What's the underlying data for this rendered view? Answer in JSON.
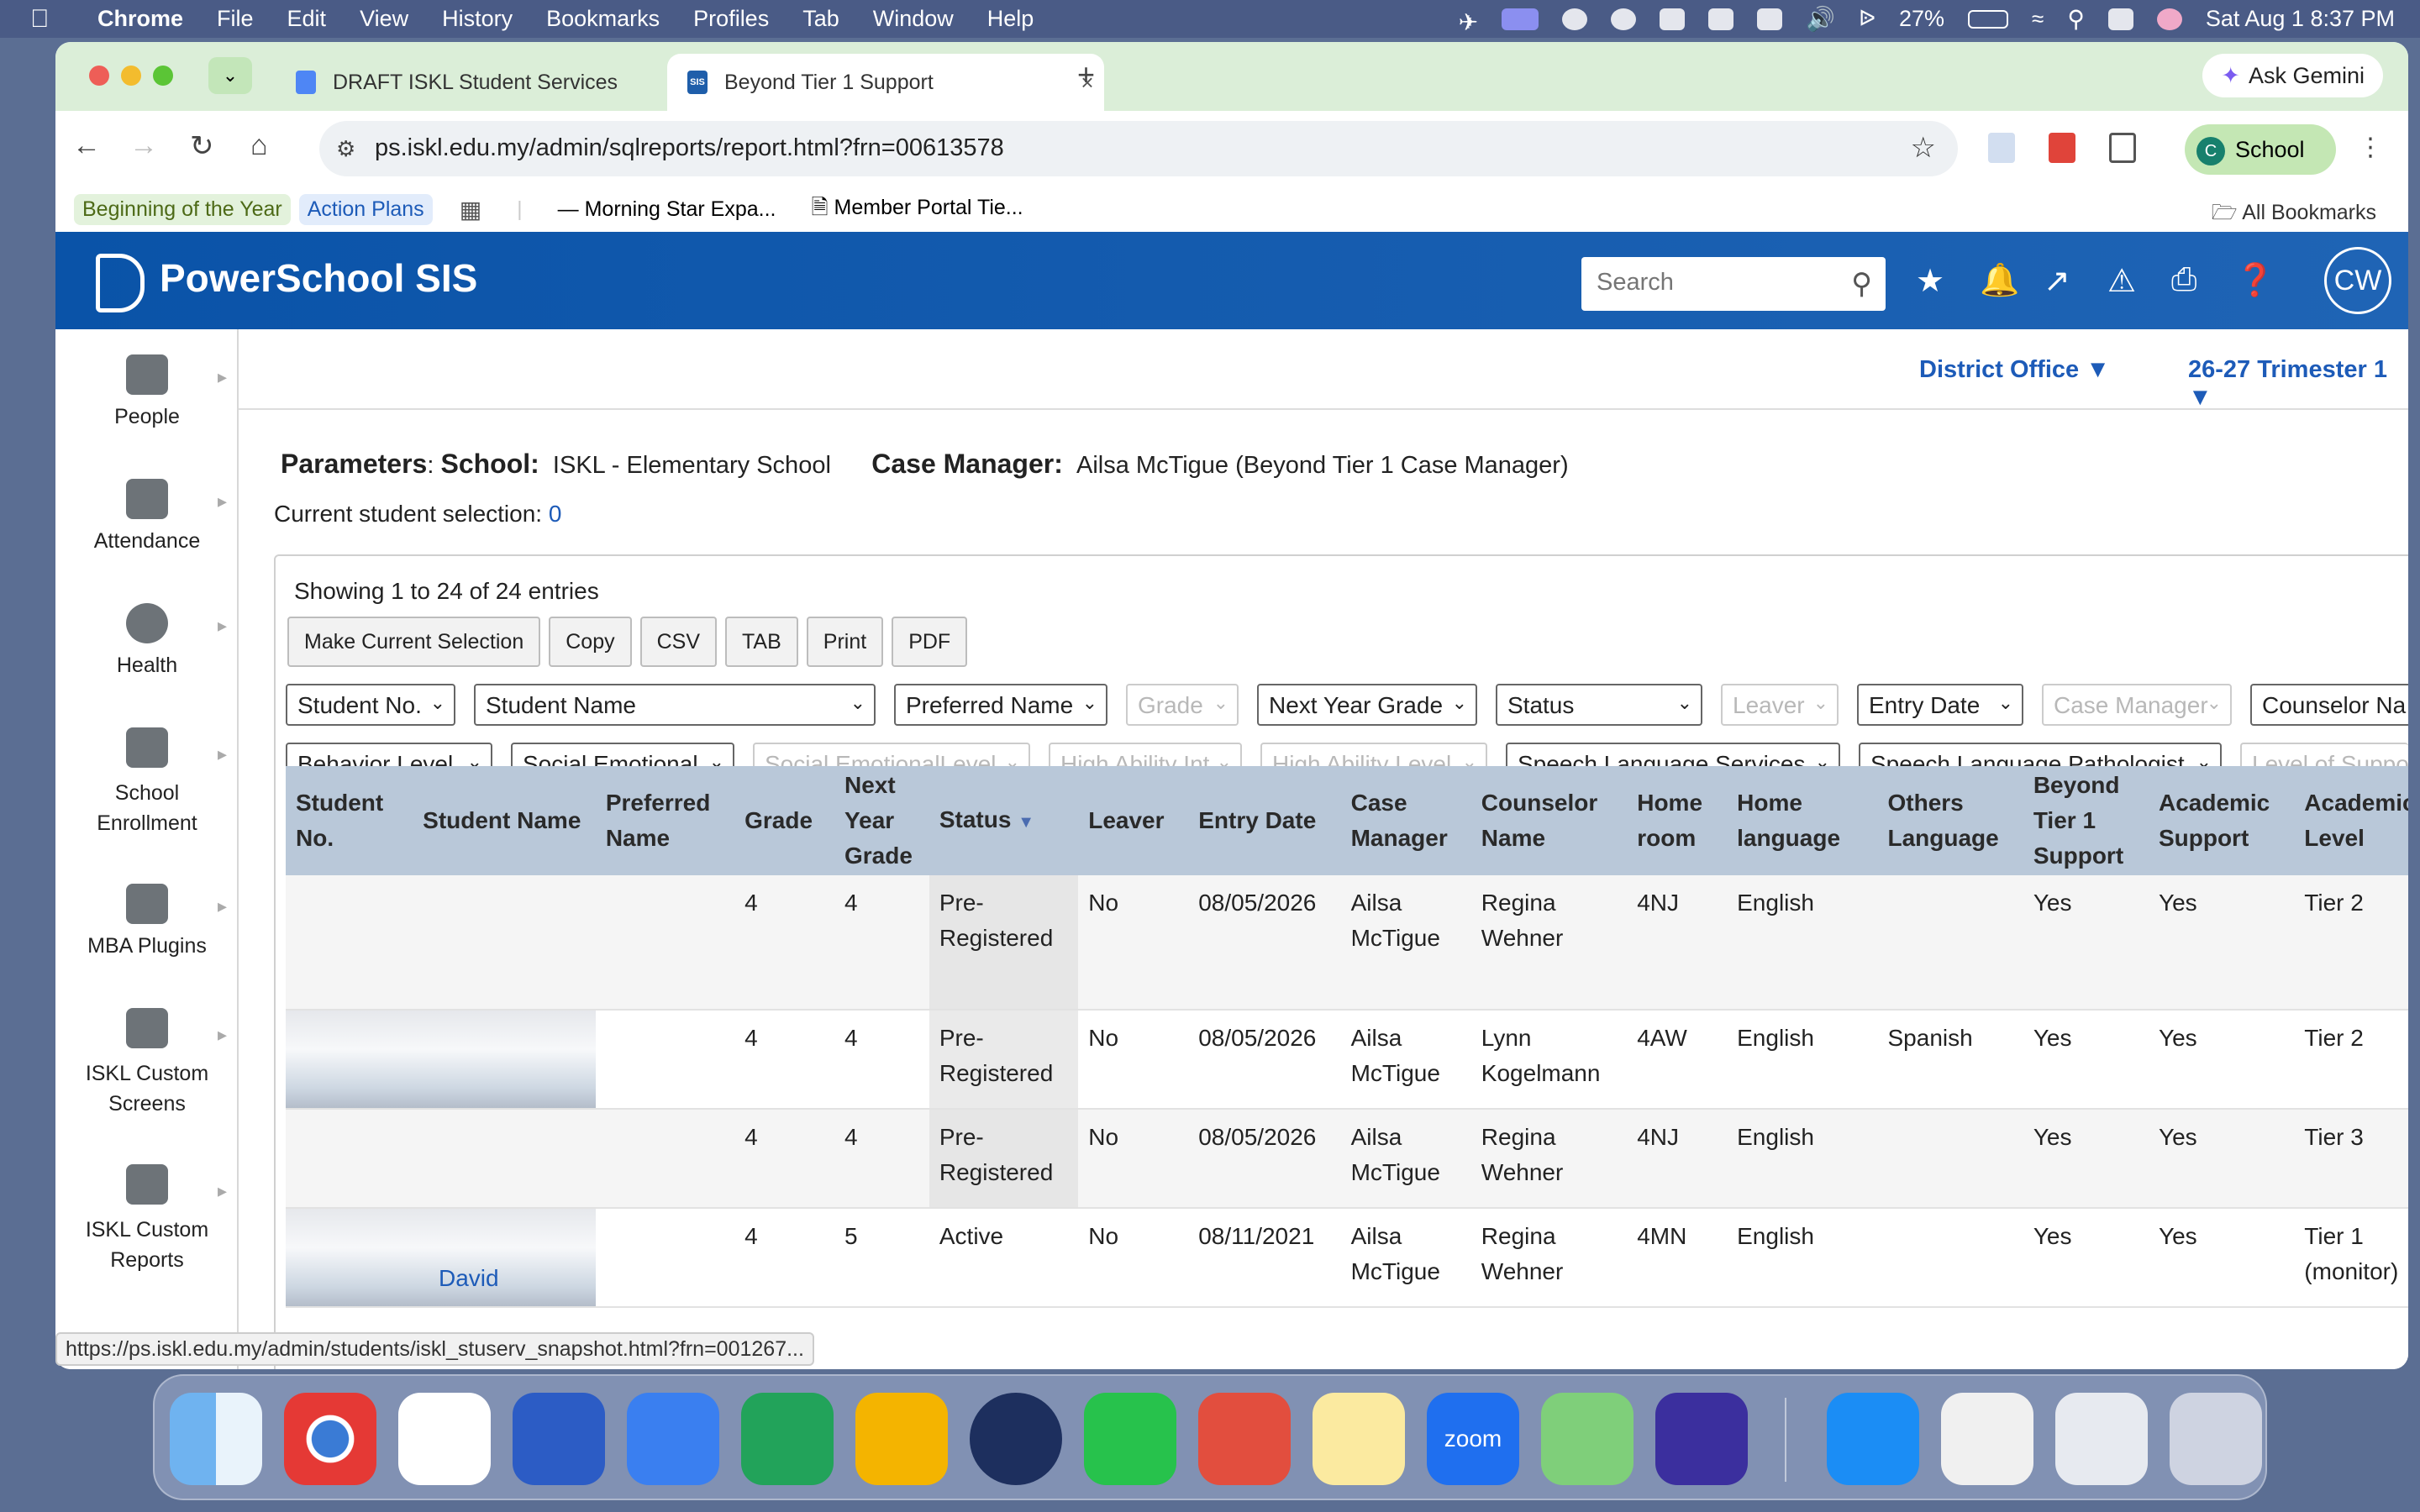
{
  "menubar": {
    "apple_icon": "apple-icon",
    "app_name": "Chrome",
    "items": [
      "File",
      "Edit",
      "View",
      "History",
      "Bookmarks",
      "Profiles",
      "Tab",
      "Window",
      "Help"
    ],
    "battery": "27%",
    "datetime": "Sat Aug 1  8:37 PM"
  },
  "browser": {
    "tabs": [
      {
        "label": "DRAFT ISKL Student Services",
        "active": false
      },
      {
        "label": "Beyond Tier 1 Support",
        "active": true
      }
    ],
    "favicon_sis": "SIS",
    "ask_gemini": "Ask Gemini",
    "url": "ps.iskl.edu.my/admin/sqlreports/report.html?frn=00613578",
    "profile_initial": "C",
    "profile_label": "School",
    "bookmarks": [
      "Beginning of the Year",
      "Action Plans",
      "Morning Star Expa...",
      "Member Portal Tie..."
    ],
    "all_bookmarks": "All Bookmarks"
  },
  "powerschool": {
    "title": "PowerSchool SIS",
    "search_placeholder": "Search",
    "user_initials": "CW",
    "district": "District Office",
    "term": "26-27 Trimester 1"
  },
  "sidebar": {
    "items": [
      {
        "label": "People",
        "icon": "people-icon"
      },
      {
        "label": "Attendance",
        "icon": "attendance-icon"
      },
      {
        "label": "Health",
        "icon": "health-icon"
      },
      {
        "label": "School Enrollment",
        "icon": "school-enrollment-icon"
      },
      {
        "label": "MBA Plugins",
        "icon": "plugin-icon"
      },
      {
        "label": "ISKL Custom Screens",
        "icon": "custom-screens-icon"
      },
      {
        "label": "ISKL Custom Reports",
        "icon": "custom-reports-icon"
      }
    ]
  },
  "report": {
    "params_label": "Parameters",
    "school_label": "School:",
    "school_value": "ISKL - Elementary School",
    "case_manager_label": "Case Manager:",
    "case_manager_value": "Ailsa McTigue (Beyond Tier 1 Case Manager)",
    "current_selection_label": "Current student selection:",
    "current_selection_count": "0",
    "showing": "Showing 1 to 24 of 24 entries",
    "buttons": [
      "Make Current Selection",
      "Copy",
      "CSV",
      "TAB",
      "Print",
      "PDF"
    ],
    "filters_row1": [
      {
        "label": "Student No.",
        "enabled": true
      },
      {
        "label": "Student Name",
        "enabled": true
      },
      {
        "label": "Preferred Name",
        "enabled": true
      },
      {
        "label": "Grade",
        "enabled": false
      },
      {
        "label": "Next Year Grade",
        "enabled": true
      },
      {
        "label": "Status",
        "enabled": true
      },
      {
        "label": "Leaver",
        "enabled": false
      },
      {
        "label": "Entry Date",
        "enabled": true
      },
      {
        "label": "Case Manager",
        "enabled": false
      },
      {
        "label": "Counselor Na",
        "enabled": true
      }
    ],
    "filters_row2": [
      {
        "label": "Behavior Level",
        "enabled": true
      },
      {
        "label": "Social Emotional",
        "enabled": true
      },
      {
        "label": "Social EmotionalLevel",
        "enabled": false
      },
      {
        "label": "High Ability Int",
        "enabled": false
      },
      {
        "label": "High Ability Level",
        "enabled": false
      },
      {
        "label": "Speech Language Services",
        "enabled": true
      },
      {
        "label": "Speech Language Pathologist",
        "enabled": true
      },
      {
        "label": "Level of Suppor",
        "enabled": false
      }
    ],
    "columns": [
      "Student No.",
      "Student Name",
      "Preferred Name",
      "Grade",
      "Next Year Grade",
      "Status",
      "Leaver",
      "Entry Date",
      "Case Manager",
      "Counselor Name",
      "Home room",
      "Home language",
      "Others Language",
      "Beyond Tier 1 Support",
      "Academic Support",
      "Academic Level"
    ],
    "rows": [
      {
        "student_no": "",
        "student_name": "",
        "preferred_name": "",
        "grade": "4",
        "next_grade": "4",
        "status": "Pre-Registered",
        "leaver": "No",
        "entry_date": "08/05/2026",
        "case_manager": "Ailsa McTigue",
        "counselor": "Regina Wehner",
        "homeroom": "4NJ",
        "home_language": "English",
        "other_language": "",
        "beyond_tier1": "Yes",
        "academic_support": "Yes",
        "academic_level": "Tier 2"
      },
      {
        "student_no": "",
        "student_name": "",
        "preferred_name": "",
        "grade": "4",
        "next_grade": "4",
        "status": "Pre-Registered",
        "leaver": "No",
        "entry_date": "08/05/2026",
        "case_manager": "Ailsa McTigue",
        "counselor": "Lynn Kogelmann",
        "homeroom": "4AW",
        "home_language": "English",
        "other_language": "Spanish",
        "beyond_tier1": "Yes",
        "academic_support": "Yes",
        "academic_level": "Tier 2"
      },
      {
        "student_no": "",
        "student_name": "",
        "preferred_name": "",
        "grade": "4",
        "next_grade": "4",
        "status": "Pre-Registered",
        "leaver": "No",
        "entry_date": "08/05/2026",
        "case_manager": "Ailsa McTigue",
        "counselor": "Regina Wehner",
        "homeroom": "4NJ",
        "home_language": "English",
        "other_language": "",
        "beyond_tier1": "Yes",
        "academic_support": "Yes",
        "academic_level": "Tier 3"
      },
      {
        "student_no": "",
        "student_name": "David",
        "preferred_name": "",
        "grade": "4",
        "next_grade": "5",
        "status": "Active",
        "leaver": "No",
        "entry_date": "08/11/2021",
        "case_manager": "Ailsa McTigue",
        "counselor": "Regina Wehner",
        "homeroom": "4MN",
        "home_language": "English",
        "other_language": "",
        "beyond_tier1": "Yes",
        "academic_support": "Yes",
        "academic_level": "Tier 1 (monitor)"
      }
    ]
  },
  "status_url": "https://ps.iskl.edu.my/admin/students/iskl_stuserv_snapshot.html?frn=001267...",
  "dock": {
    "apps": [
      "Finder",
      "Chrome",
      "Photos",
      "Keynote",
      "Docs",
      "Sheets",
      "Slides",
      "ISKL",
      "WhatsApp",
      "Todoist",
      "Notes",
      "Zoom",
      "Maps",
      "Grammarly",
      "App Store",
      "Preview",
      "Screenshot",
      "Trash"
    ],
    "zoom_label": "zoom"
  }
}
